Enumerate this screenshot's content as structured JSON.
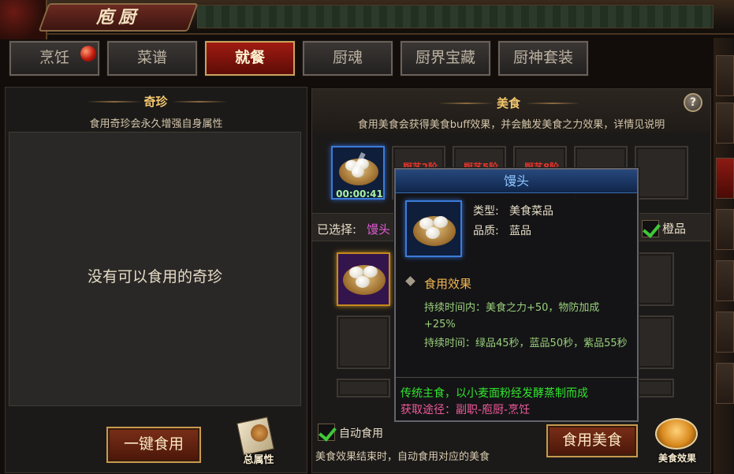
{
  "window": {
    "title": "庖厨"
  },
  "tabs": [
    {
      "label": "烹饪",
      "active": false,
      "has_alert": true
    },
    {
      "label": "菜谱",
      "active": false
    },
    {
      "label": "就餐",
      "active": true
    },
    {
      "label": "厨魂",
      "active": false
    },
    {
      "label": "厨界宝藏",
      "active": false
    },
    {
      "label": "厨神套装",
      "active": false
    }
  ],
  "left": {
    "title": "奇珍",
    "subtitle": "食用奇珍会永久增强自身属性",
    "empty_message": "没有可以食用的奇珍",
    "eat_all_button": "一键食用",
    "attributes_label": "总属性"
  },
  "right": {
    "title": "美食",
    "subtitle": "食用美食会获得美食buff效果，并会触发美食之力效果，详情见说明",
    "help_icon": "?",
    "active_slot": {
      "item": "馒头",
      "timer": "00:00:41"
    },
    "locked_slots": [
      "厨艺2阶",
      "厨艺5阶",
      "厨艺8阶"
    ],
    "selected_label": "已选择:",
    "selected_value": "馒头",
    "filter_label": "橙品",
    "filter_checked": true,
    "auto_eat_label": "自动食用",
    "auto_eat_checked": true,
    "auto_eat_note": "美食效果结束时，自动食用对应的美食",
    "eat_button": "食用美食",
    "effects_label": "美食效果"
  },
  "tooltip": {
    "name": "馒头",
    "type_label": "类型:",
    "type_value": "美食菜品",
    "quality_label": "品质:",
    "quality_value": "蓝品",
    "effect_header": "食用效果",
    "effect_line1": "持续时间内：美食之力+50，物防加成+25%",
    "effect_line2": "持续时间：绿品45秒，蓝品50秒，紫品55秒",
    "flavor": "传统主食，以小麦面粉经发酵蒸制而成",
    "source": "获取途径：副职-庖厨-烹饪"
  },
  "colors": {
    "accent_gold": "#f3c76e",
    "tab_active": "#a01b12",
    "tooltip_title": "#8fc7ff",
    "flavor_green": "#32e42f",
    "source_pink": "#ef5a9b"
  }
}
